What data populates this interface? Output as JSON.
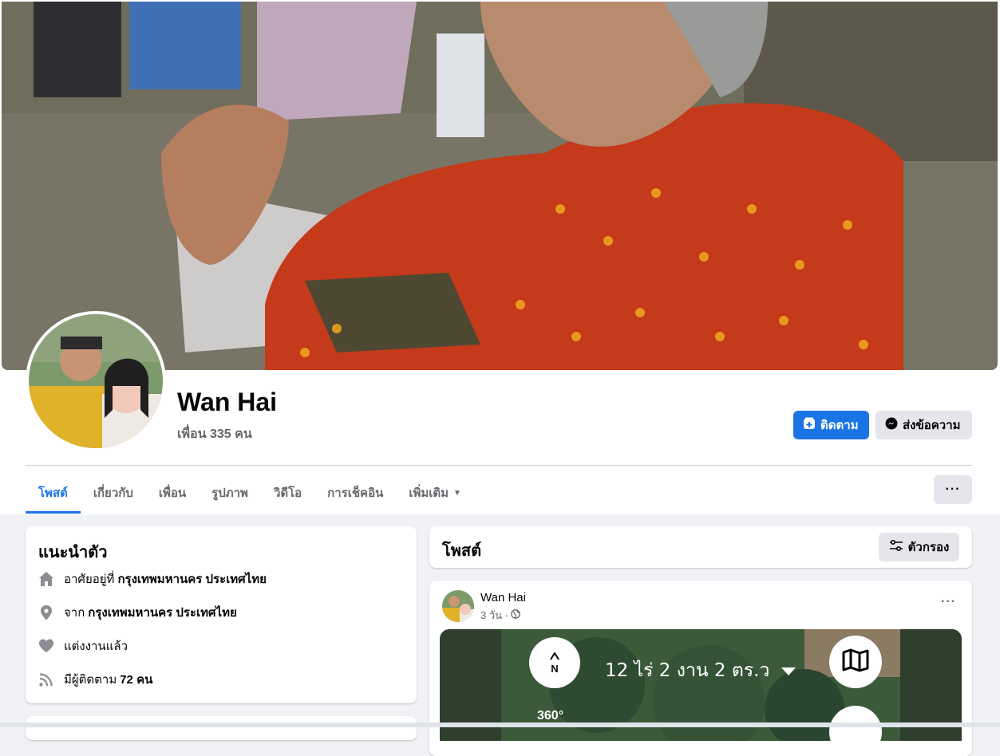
{
  "profile": {
    "name": "Wan Hai",
    "friends": "เพื่อน 335 คน",
    "follow_label": "ติดตาม",
    "message_label": "ส่งข้อความ"
  },
  "tabs": [
    {
      "label": "โพสต์",
      "active": true
    },
    {
      "label": "เกี่ยวกับ"
    },
    {
      "label": "เพื่อน"
    },
    {
      "label": "รูปภาพ"
    },
    {
      "label": "วิดีโอ"
    },
    {
      "label": "การเช็คอิน"
    },
    {
      "label": "เพิ่มเติม"
    }
  ],
  "more_options": "···",
  "intro": {
    "title": "แนะนำตัว",
    "lives_prefix": "อาศัยอยู่ที่",
    "lives_value": "กรุงเทพมหานคร ประเทศไทย",
    "from_prefix": "จาก",
    "from_value": "กรุงเทพมหานคร ประเทศไทย",
    "relationship": "แต่งงานแล้ว",
    "followers_prefix": "มีผู้ติดตาม",
    "followers_value": "72 คน"
  },
  "posts": {
    "title": "โพสต์",
    "filter_label": "ตัวกรอง"
  },
  "post": {
    "author": "Wan Hai",
    "time": "3 วัน ·",
    "options": "···",
    "media": {
      "area_text": "12 ไร่ 2 งาน 2 ตร.ว",
      "compass_letter": "N",
      "view_label": "360°"
    }
  },
  "colors": {
    "accent": "#1b74e4",
    "background": "#f0f2f5",
    "secondary_button": "#e4e6eb"
  }
}
